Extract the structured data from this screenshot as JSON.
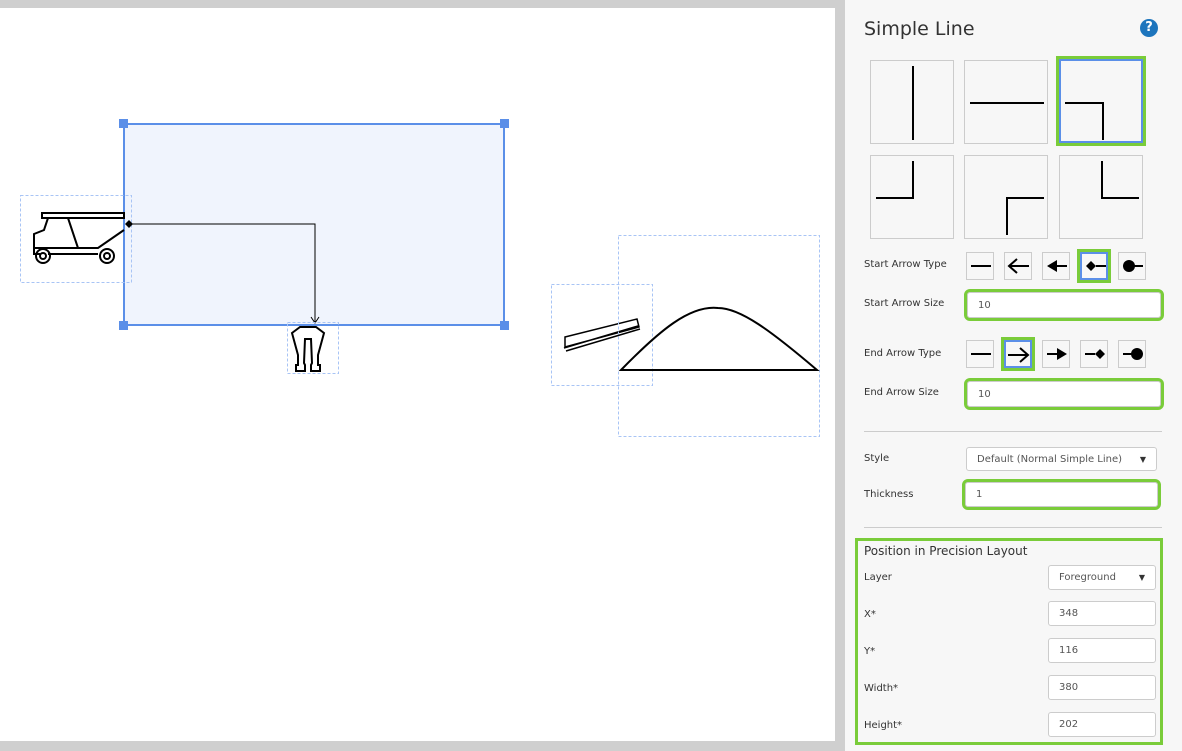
{
  "panel": {
    "title": "Simple Line",
    "help_icon": "question-circle-icon",
    "line_types": [
      "vertical",
      "horizontal",
      "right-down",
      "up-left",
      "right-down-corner",
      "down-right"
    ],
    "selected_line_type": 2,
    "start_arrow_type": {
      "label": "Start Arrow Type",
      "options": [
        "none",
        "open-arrow",
        "filled-arrow",
        "diamond",
        "circle"
      ],
      "selected": 3
    },
    "start_arrow_size": {
      "label": "Start Arrow Size",
      "value": "10"
    },
    "end_arrow_type": {
      "label": "End Arrow Type",
      "options": [
        "none",
        "open-arrow",
        "filled-arrow",
        "diamond",
        "circle"
      ],
      "selected": 1
    },
    "end_arrow_size": {
      "label": "End Arrow Size",
      "value": "10"
    },
    "style": {
      "label": "Style",
      "value": "Default (Normal Simple Line)"
    },
    "thickness": {
      "label": "Thickness",
      "value": "1"
    },
    "position": {
      "heading": "Position in Precision Layout",
      "layer": {
        "label": "Layer",
        "value": "Foreground"
      },
      "x": {
        "label": "X*",
        "value": "348"
      },
      "y": {
        "label": "Y*",
        "value": "116"
      },
      "width": {
        "label": "Width*",
        "value": "380"
      },
      "height": {
        "label": "Height*",
        "value": "202"
      }
    }
  },
  "colors": {
    "accent_green": "#7acc3a",
    "selection_blue": "#5b8fe8",
    "help_blue": "#1d75bd"
  }
}
